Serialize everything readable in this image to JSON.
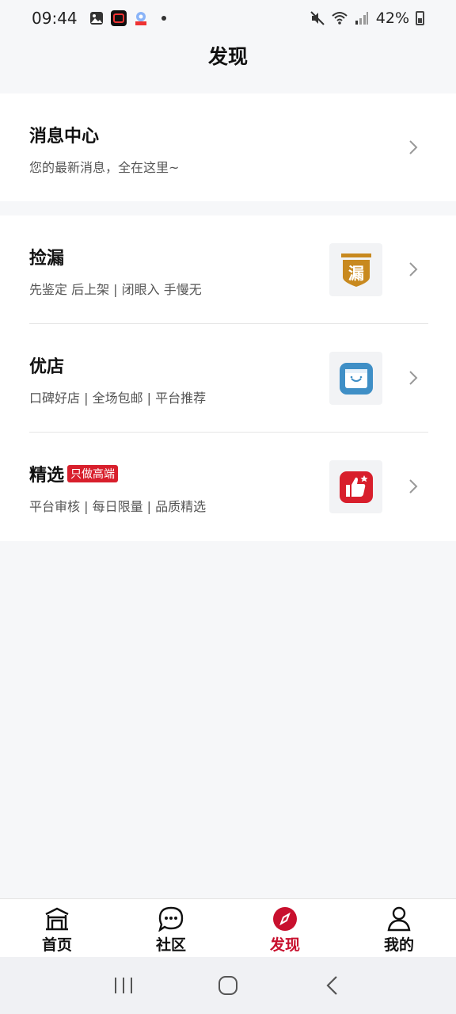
{
  "status_bar": {
    "time": "09:44",
    "battery": "42%"
  },
  "header": {
    "title": "发现"
  },
  "message_center": {
    "title": "消息中心",
    "subtitle": "您的最新消息，全在这里~"
  },
  "items": [
    {
      "title": "捡漏",
      "subtitle": "先鉴定 后上架 | 闭眼入 手慢无",
      "icon": "lou-shield-icon",
      "thumb_glyph": "漏",
      "color": "#c8891f"
    },
    {
      "title": "优店",
      "subtitle": "口碑好店 | 全场包邮 | 平台推荐",
      "icon": "shop-box-icon",
      "color": "#3f8fc6"
    },
    {
      "title": "精选",
      "badge": "只做高端",
      "subtitle": "平台审核 | 每日限量 | 品质精选",
      "icon": "thumbs-up-icon",
      "color": "#d81f2c"
    }
  ],
  "tabs": [
    {
      "label": "首页",
      "icon": "home-icon"
    },
    {
      "label": "社区",
      "icon": "chat-icon"
    },
    {
      "label": "发现",
      "icon": "compass-icon",
      "active": true
    },
    {
      "label": "我的",
      "icon": "profile-icon"
    }
  ],
  "colors": {
    "accent": "#c8102e",
    "background": "#f6f7f9"
  }
}
